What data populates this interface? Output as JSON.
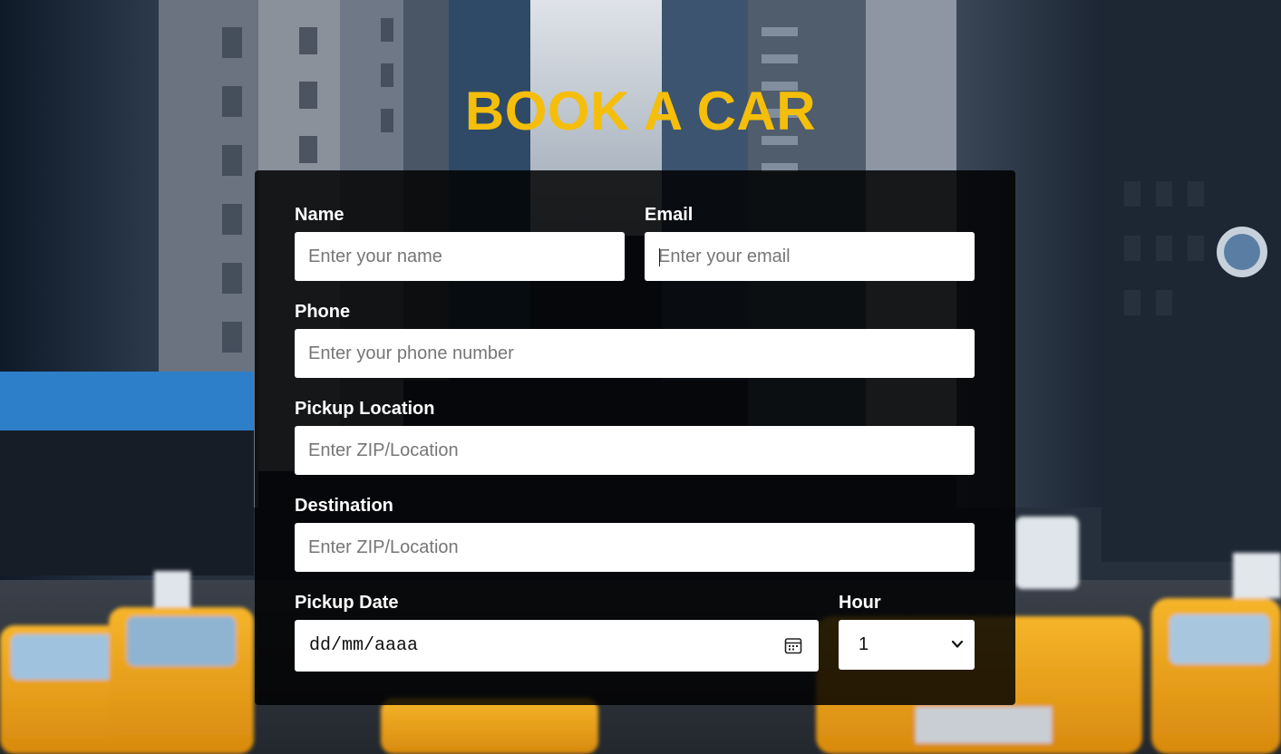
{
  "page": {
    "title": "BOOK A CAR"
  },
  "form": {
    "name": {
      "label": "Name",
      "placeholder": "Enter your name"
    },
    "email": {
      "label": "Email",
      "placeholder": "Enter your email"
    },
    "phone": {
      "label": "Phone",
      "placeholder": "Enter your phone number"
    },
    "pickup_location": {
      "label": "Pickup Location",
      "placeholder": "Enter ZIP/Location"
    },
    "destination": {
      "label": "Destination",
      "placeholder": "Enter ZIP/Location"
    },
    "pickup_date": {
      "label": "Pickup Date",
      "placeholder": "dd/mm/aaaa",
      "icon": "calendar-icon"
    },
    "hour": {
      "label": "Hour",
      "value": "1",
      "icon": "chevron-down-icon"
    }
  },
  "colors": {
    "accent": "#f5be0b",
    "panel": "#000000",
    "taxi": "#f2a81d"
  }
}
